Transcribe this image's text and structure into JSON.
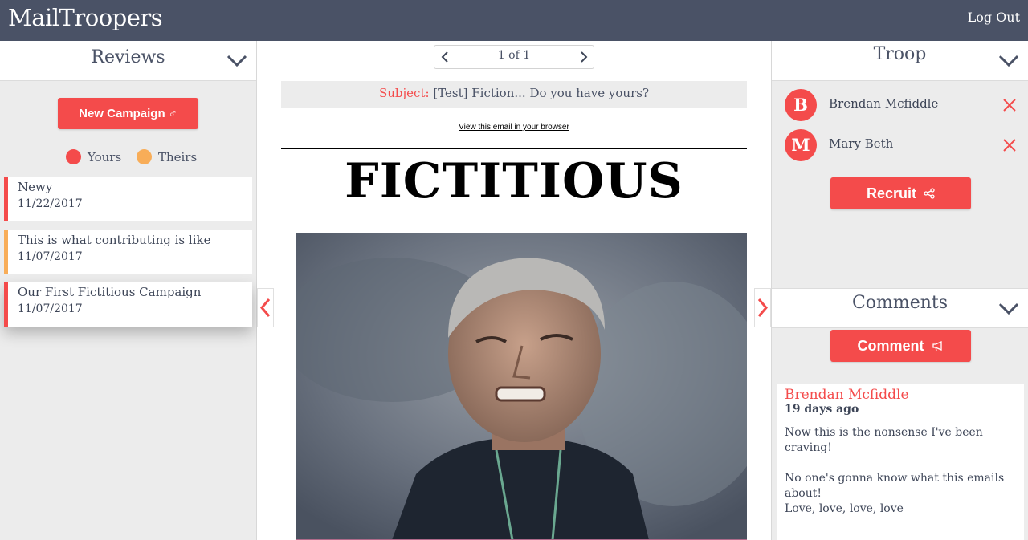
{
  "app": {
    "brand": "MailTroopers",
    "logout_label": "Log Out"
  },
  "reviews": {
    "title": "Reviews",
    "new_campaign_label": "New Campaign",
    "legend": {
      "yours": "Yours",
      "theirs": "Theirs",
      "yours_color": "#f44b4b",
      "theirs_color": "#f8ad58"
    },
    "campaigns": [
      {
        "name": "Newy",
        "date": "11/22/2017",
        "owner": "yours"
      },
      {
        "name": "This is what contributing is like",
        "date": "11/07/2017",
        "owner": "theirs"
      },
      {
        "name": "Our First Fictitious Campaign",
        "date": "11/07/2017",
        "owner": "yours"
      }
    ]
  },
  "email": {
    "pager_text": "1 of 1",
    "subject_label": "Subject:",
    "subject": "[Test] Fiction... Do you have yours?",
    "view_link": "View this email in your browser",
    "headline": "FICTITIOUS"
  },
  "troop": {
    "title": "Troop",
    "members": [
      {
        "initial": "B",
        "name": "Brendan Mcfiddle"
      },
      {
        "initial": "M",
        "name": "Mary Beth"
      }
    ],
    "recruit_label": "Recruit"
  },
  "comments": {
    "title": "Comments",
    "comment_label": "Comment",
    "items": [
      {
        "author": "Brendan Mcfiddle",
        "when": "19 days ago",
        "body": "Now this is the nonsense I've been craving!\n\nNo one's gonna know what this emails about!\nLove, love, love, love"
      }
    ]
  },
  "colors": {
    "accent": "#f44b4b",
    "topbar": "#4a5266",
    "panel_bg": "#ececec"
  }
}
